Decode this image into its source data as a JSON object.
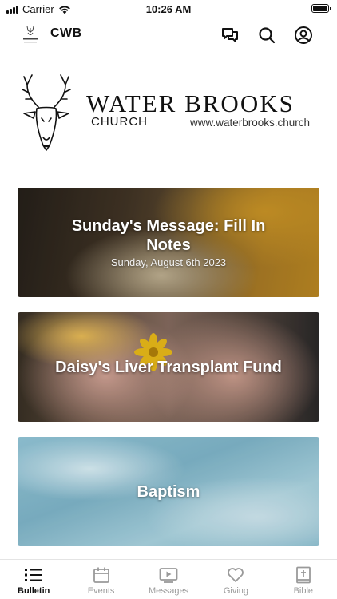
{
  "status_bar": {
    "carrier": "Carrier",
    "time": "10:26 AM"
  },
  "app_bar": {
    "title": "CWB",
    "icons": [
      "chat-icon",
      "search-icon",
      "profile-icon"
    ]
  },
  "brand": {
    "name": "WATER BROOKS",
    "sub": "CHURCH",
    "url": "www.waterbrooks.church"
  },
  "cards": [
    {
      "title": "Sunday's Message: Fill In Notes",
      "subtitle": "Sunday, August 6th 2023"
    },
    {
      "title": "Daisy's Liver Transplant Fund"
    },
    {
      "title": "Baptism"
    }
  ],
  "tabs": [
    {
      "label": "Bulletin",
      "icon": "bulletin-icon",
      "active": true
    },
    {
      "label": "Events",
      "icon": "calendar-icon"
    },
    {
      "label": "Messages",
      "icon": "video-icon"
    },
    {
      "label": "Giving",
      "icon": "heart-icon"
    },
    {
      "label": "Bible",
      "icon": "bible-icon"
    }
  ],
  "colors": {
    "active_tab": "#111111",
    "inactive_tab": "#9a9a9a"
  }
}
